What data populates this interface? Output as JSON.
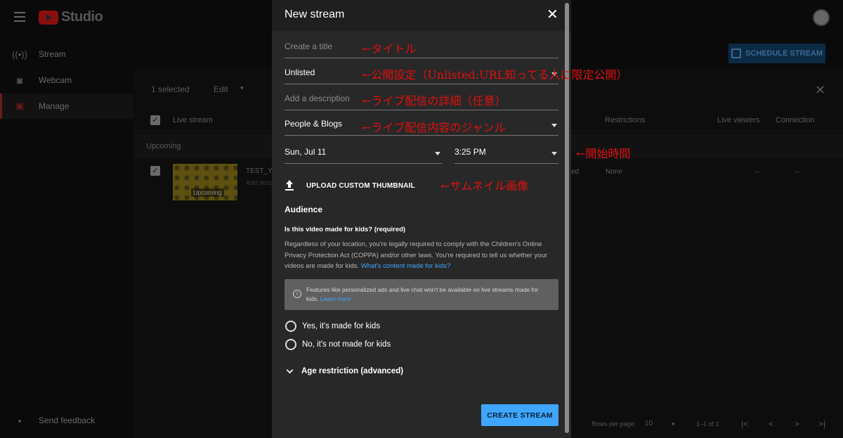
{
  "app": {
    "name": "Studio"
  },
  "sidebar": {
    "items": [
      {
        "label": "Stream",
        "icon": "broadcast-icon"
      },
      {
        "label": "Webcam",
        "icon": "camera-icon"
      },
      {
        "label": "Manage",
        "icon": "calendar-icon"
      }
    ],
    "feedback": "Send feedback"
  },
  "toolbar": {
    "schedule": "SCHEDULE STREAM"
  },
  "selection": {
    "count": "1 selected",
    "edit": "Edit"
  },
  "table": {
    "headers": {
      "live_stream": "Live stream",
      "restrictions": "Restrictions",
      "live_viewers": "Live viewers",
      "connection": "Connection"
    },
    "section": "Upcoming",
    "row": {
      "title": "TEST_Y",
      "desc": "Add desc",
      "badge": "Upcoming",
      "visibility": "ed",
      "restrictions": "None",
      "viewers": "–",
      "connection": "–"
    }
  },
  "pagination": {
    "rows_label": "Rows per page:",
    "rows_value": "10",
    "range": "1–1 of 1"
  },
  "modal": {
    "title": "New stream",
    "title_placeholder": "Create a title",
    "visibility": "Unlisted",
    "description_placeholder": "Add a description",
    "category": "People & Blogs",
    "date": "Sun, Jul 11",
    "time": "3:25 PM",
    "upload_thumbnail": "UPLOAD CUSTOM THUMBNAIL",
    "audience_heading": "Audience",
    "kids_question": "Is this video made for kids? (required)",
    "kids_paragraph": "Regardless of your location, you're legally required to comply with the Children's Online Privacy Protection Act (COPPA) and/or other laws. You're required to tell us whether your videos are made for kids. ",
    "kids_link": "What's content made for kids?",
    "info_text": "Features like personalized ads and live chat won't be available on live streams made for kids. ",
    "info_link": "Learn more",
    "radio_yes": "Yes, it's made for kids",
    "radio_no": "No, it's not made for kids",
    "age_restriction": "Age restriction (advanced)",
    "create_button": "CREATE STREAM"
  },
  "annotations": {
    "title": "←タイトル",
    "visibility": "←公開設定（Unlisted:URL知ってる人に限定公開）",
    "description": "←ライブ配信の詳細（任意）",
    "category": "←ライブ配信内容のジャンル",
    "start_time": "←開始時間",
    "thumbnail": "←サムネイル画像"
  },
  "colors": {
    "accent": "#3ea6ff",
    "annotation": "#e01010",
    "modal_bg": "#282828"
  }
}
